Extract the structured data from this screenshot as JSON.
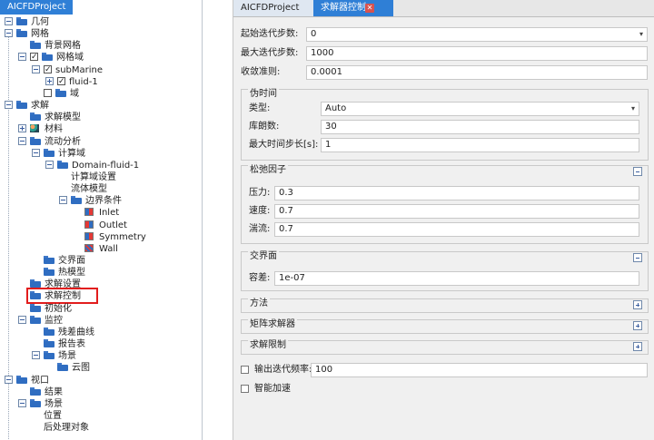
{
  "left_panel": {
    "title": "AICFDProject",
    "tree": [
      {
        "label": "几何",
        "level": 0,
        "expander": "minus",
        "icon": "folder"
      },
      {
        "label": "网格",
        "level": 0,
        "expander": "minus",
        "icon": "folder"
      },
      {
        "label": "背景网格",
        "level": 1,
        "icon": "folder"
      },
      {
        "label": "网格域",
        "level": 1,
        "expander": "minus",
        "checked": true,
        "icon": "folder"
      },
      {
        "label": "subMarine",
        "level": 2,
        "expander": "minus",
        "checked": true
      },
      {
        "label": "fluid-1",
        "level": 3,
        "expander": "plus",
        "checked": true
      },
      {
        "label": "域",
        "level": 2,
        "checked": false,
        "icon": "folder"
      },
      {
        "label": "求解",
        "level": 0,
        "expander": "minus",
        "icon": "folder"
      },
      {
        "label": "求解模型",
        "level": 1,
        "icon": "folder"
      },
      {
        "label": "材料",
        "level": 1,
        "expander": "plus",
        "icon": "material"
      },
      {
        "label": "流动分析",
        "level": 1,
        "expander": "minus",
        "icon": "folder"
      },
      {
        "label": "计算域",
        "level": 2,
        "expander": "minus",
        "icon": "folder"
      },
      {
        "label": "Domain-fluid-1",
        "level": 3,
        "expander": "minus",
        "icon": "folder"
      },
      {
        "label": "计算域设置",
        "level": 4
      },
      {
        "label": "流体模型",
        "level": 4
      },
      {
        "label": "边界条件",
        "level": 4,
        "expander": "minus",
        "icon": "folder"
      },
      {
        "label": "Inlet",
        "level": 5,
        "icon": "inlet"
      },
      {
        "label": "Outlet",
        "level": 5,
        "icon": "outlet"
      },
      {
        "label": "Symmetry",
        "level": 5,
        "icon": "symmetry"
      },
      {
        "label": "Wall",
        "level": 5,
        "icon": "wall"
      },
      {
        "label": "交界面",
        "level": 2,
        "icon": "folder"
      },
      {
        "label": "热模型",
        "level": 2,
        "icon": "folder"
      },
      {
        "label": "求解设置",
        "level": 1,
        "icon": "folder"
      },
      {
        "label": "求解控制",
        "level": 1,
        "icon": "folder",
        "selected": true
      },
      {
        "label": "初始化",
        "level": 1,
        "icon": "folder"
      },
      {
        "label": "监控",
        "level": 1,
        "expander": "minus",
        "icon": "folder"
      },
      {
        "label": "残差曲线",
        "level": 2,
        "icon": "folder"
      },
      {
        "label": "报告表",
        "level": 2,
        "icon": "folder"
      },
      {
        "label": "场景",
        "level": 2,
        "expander": "minus",
        "icon": "folder"
      },
      {
        "label": "云图",
        "level": 3,
        "icon": "folder"
      },
      {
        "label": "视口",
        "level": 0,
        "expander": "minus",
        "icon": "folder"
      },
      {
        "label": "结果",
        "level": 1,
        "icon": "folder"
      },
      {
        "label": "场景",
        "level": 1,
        "expander": "minus",
        "icon": "folder"
      },
      {
        "label": "位置",
        "level": 2
      },
      {
        "label": "后处理对象",
        "level": 2
      }
    ]
  },
  "right_panel": {
    "tabs": [
      {
        "label": "AICFDProject"
      },
      {
        "label": "求解器控制"
      }
    ],
    "fields": {
      "start_iter": {
        "label": "起始迭代步数:",
        "value": "0"
      },
      "max_iter": {
        "label": "最大迭代步数:",
        "value": "1000"
      },
      "convergence": {
        "label": "收敛准则:",
        "value": "0.0001"
      }
    },
    "pseudo_time": {
      "title": "伪时间",
      "type_label": "类型:",
      "type_value": "Auto",
      "courant_label": "库朗数:",
      "courant_value": "30",
      "max_step_label": "最大时间步长[s]:",
      "max_step_value": "1"
    },
    "relaxation": {
      "title": "松弛因子",
      "pressure_label": "压力:",
      "pressure_value": "0.3",
      "velocity_label": "速度:",
      "velocity_value": "0.7",
      "turbulence_label": "湍流:",
      "turbulence_value": "0.7"
    },
    "interface": {
      "title": "交界面",
      "tolerance_label": "容差:",
      "tolerance_value": "1e-07"
    },
    "collapsed_groups": [
      {
        "title": "方法"
      },
      {
        "title": "矩阵求解器"
      },
      {
        "title": "求解限制"
      }
    ],
    "output_freq": {
      "label": "输出迭代频率:",
      "value": "100"
    },
    "smart_accel": {
      "label": "智能加速"
    }
  }
}
